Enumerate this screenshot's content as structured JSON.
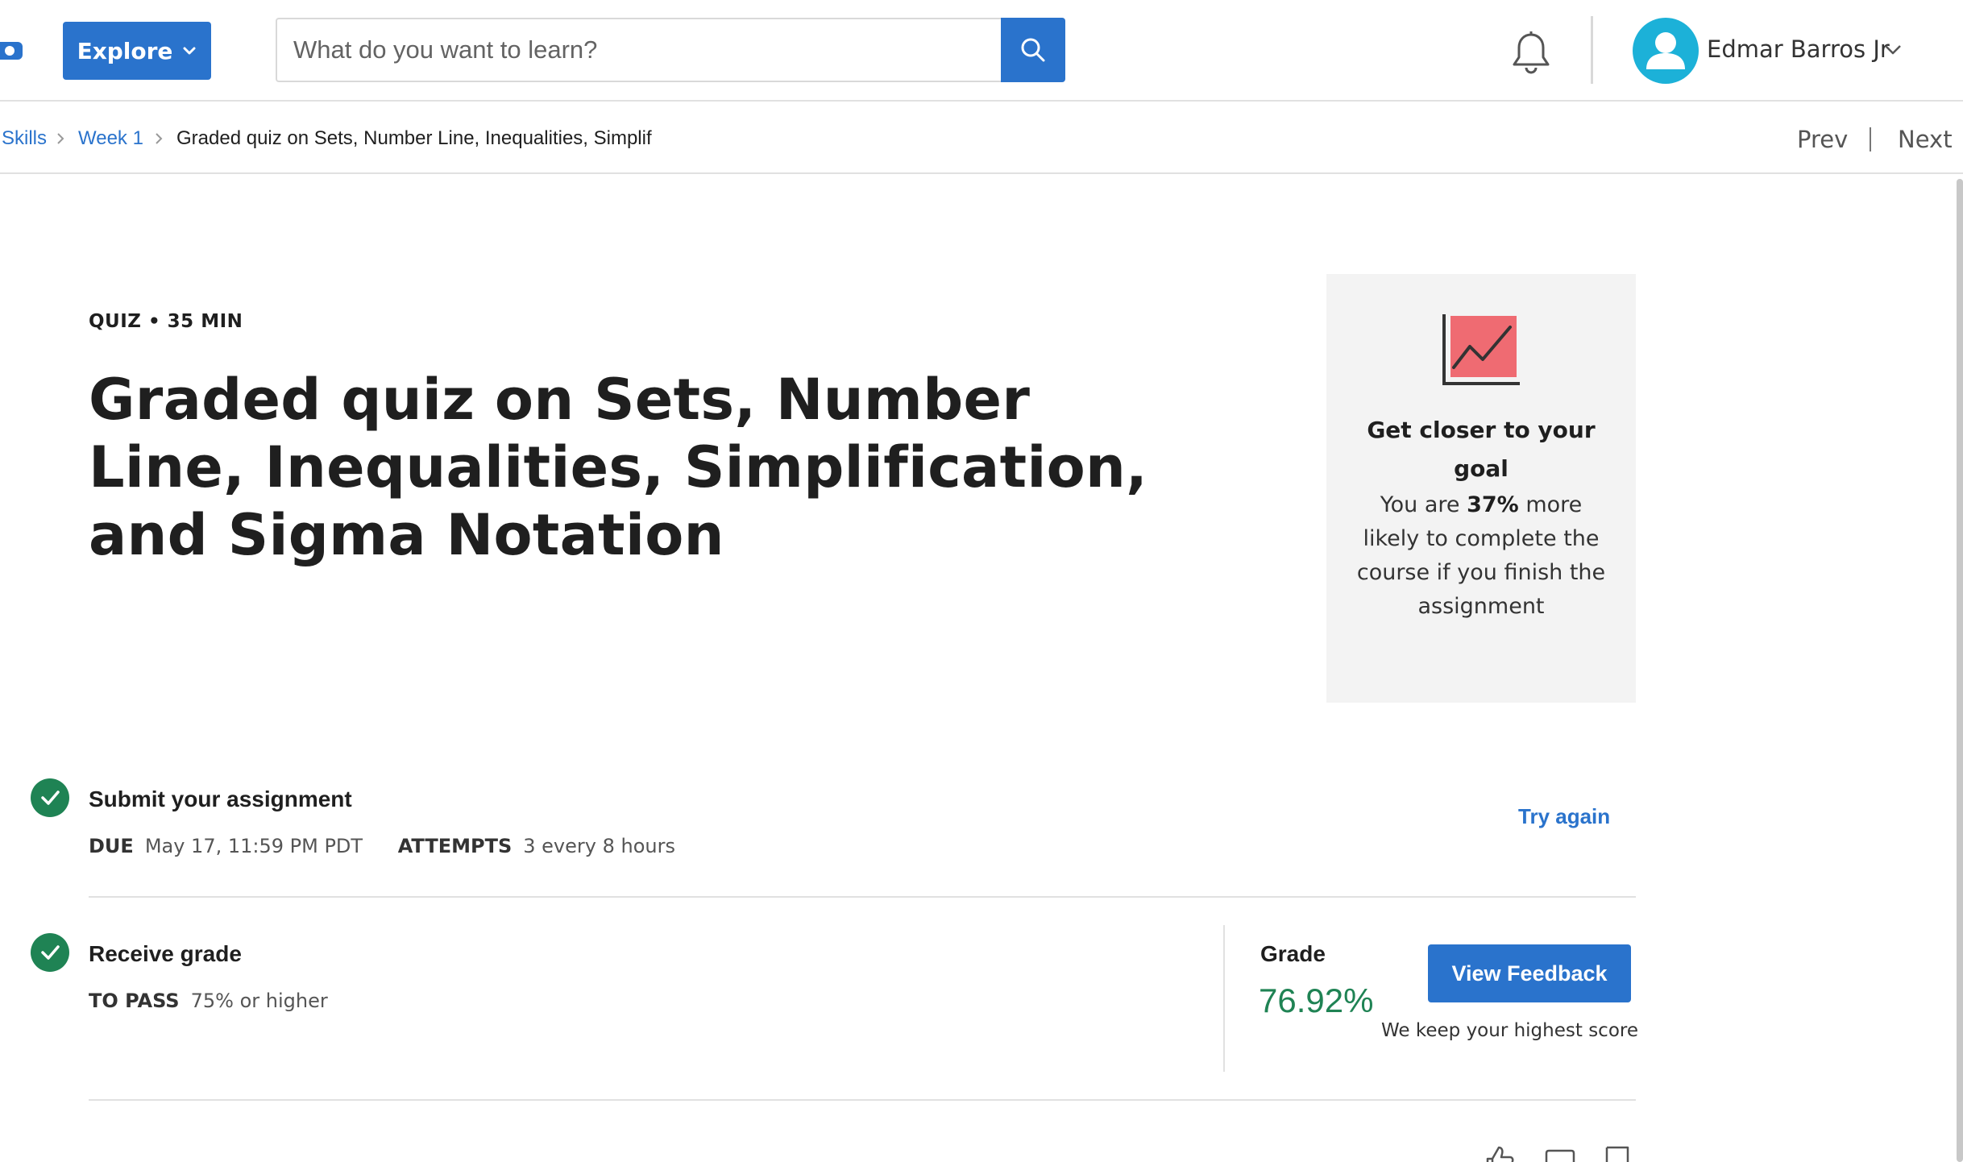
{
  "header": {
    "explore_label": "Explore",
    "search_placeholder": "What do you want to learn?",
    "user_name": "Edmar Barros Jr",
    "icons": [
      "logo-fragment-icon",
      "chevron-down-icon",
      "search-icon",
      "bell-icon",
      "user-avatar-icon"
    ]
  },
  "breadcrumb": {
    "items": [
      "Skills",
      "Week 1"
    ],
    "current": "Graded quiz on Sets, Number Line, Inequalities, Simplific"
  },
  "pager": {
    "prev": "Prev",
    "next": "Next"
  },
  "hero": {
    "meta": "QUIZ • 35 MIN",
    "title": "Graded quiz on Sets, Number Line, Inequalities, Simplification, and Sigma Notation"
  },
  "goal_card": {
    "heading": "Get closer to your goal",
    "text_before": "You are ",
    "percent": "37%",
    "text_after": " more likely to complete the course if you finish the assignment"
  },
  "submit_step": {
    "title": "Submit your assignment",
    "due_label": "DUE",
    "due_value": "May 17, 11:59 PM PDT",
    "attempts_label": "ATTEMPTS",
    "attempts_value": "3 every 8 hours",
    "action": "Try again"
  },
  "grade_step": {
    "title": "Receive grade",
    "pass_label": "TO PASS",
    "pass_value": "75% or higher",
    "grade_label": "Grade",
    "grade_value": "76.92%",
    "button": "View Feedback",
    "note": "We keep your highest score"
  },
  "colors": {
    "primary": "#2a73cc",
    "success": "#1f8354",
    "avatar": "#1cb1d8",
    "goal_chart": "#ef6b72",
    "card_bg": "#f3f3f3"
  },
  "bottom_icons": [
    "thumbs-up-icon",
    "comment-icon",
    "flag-icon"
  ]
}
